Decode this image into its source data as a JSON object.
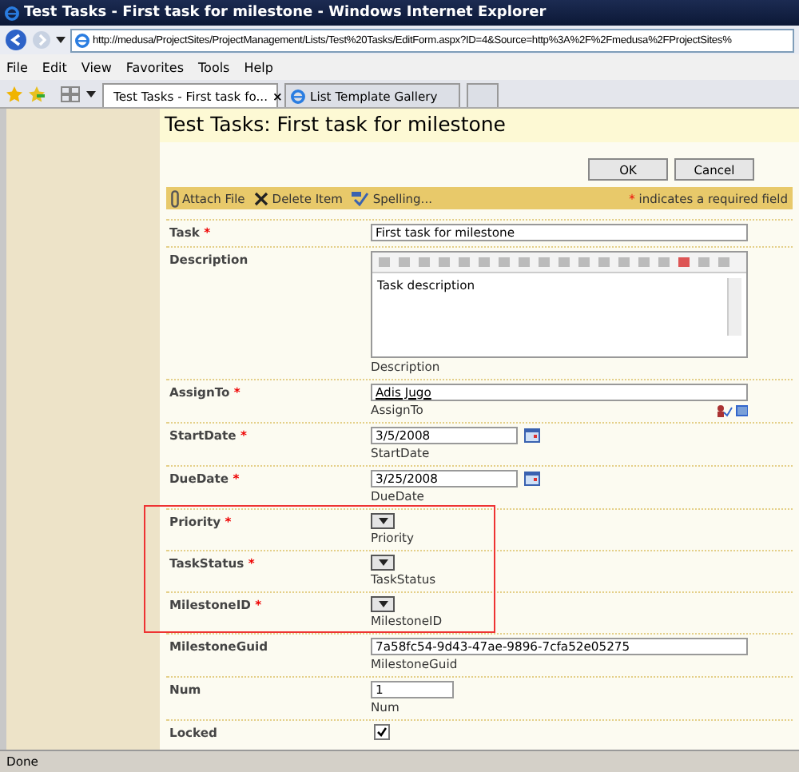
{
  "window": {
    "title": "Test Tasks - First task for milestone - Windows Internet Explorer"
  },
  "address": {
    "value": "http://medusa/ProjectSites/ProjectManagement/Lists/Test%20Tasks/EditForm.aspx?ID=4&Source=http%3A%2F%2Fmedusa%2FProjectSites%"
  },
  "menu": [
    "File",
    "Edit",
    "View",
    "Favorites",
    "Tools",
    "Help"
  ],
  "tabs": [
    {
      "label": "Test Tasks - First task fo...",
      "close": "×",
      "selected": true
    },
    {
      "label": "List Template Gallery",
      "selected": false
    }
  ],
  "page": {
    "title": "Test Tasks: First task for milestone",
    "buttons": [
      "OK",
      "Cancel"
    ],
    "toolbar": [
      "Attach File",
      "Delete Item",
      "Spelling..."
    ],
    "required_star": "*",
    "required_note": "indicates a required field",
    "fields": [
      {
        "label": "Task",
        "required": true,
        "kind": "text",
        "value": "First task for milestone"
      },
      {
        "label": "Description",
        "required": false,
        "kind": "richtext",
        "value": "Task description",
        "caption": "Description"
      },
      {
        "label": "AssignTo",
        "required": true,
        "kind": "person",
        "value": "Adis Jugo",
        "caption": "AssignTo"
      },
      {
        "label": "StartDate",
        "required": true,
        "kind": "date",
        "value": "3/5/2008",
        "caption": "StartDate"
      },
      {
        "label": "DueDate",
        "required": true,
        "kind": "date",
        "value": "3/25/2008",
        "caption": "DueDate"
      },
      {
        "label": "Priority",
        "required": true,
        "kind": "select",
        "caption": "Priority"
      },
      {
        "label": "TaskStatus",
        "required": true,
        "kind": "select",
        "caption": "TaskStatus"
      },
      {
        "label": "MilestoneID",
        "required": true,
        "kind": "select",
        "caption": "MilestoneID"
      },
      {
        "label": "MilestoneGuid",
        "required": false,
        "kind": "text",
        "value": "7a58fc54-9d43-47ae-9896-7cfa52e05275",
        "caption": "MilestoneGuid"
      },
      {
        "label": "Num",
        "required": false,
        "kind": "short",
        "value": "1",
        "caption": "Num"
      },
      {
        "label": "Locked",
        "required": false,
        "kind": "checkbox",
        "checked": true
      }
    ]
  },
  "status_bar": {
    "text": "Done"
  }
}
